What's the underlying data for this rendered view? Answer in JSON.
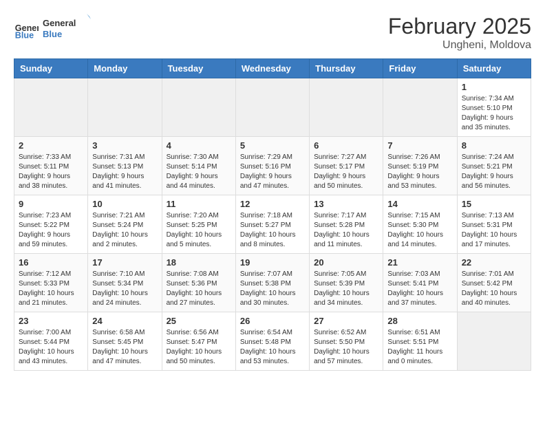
{
  "header": {
    "logo_line1": "General",
    "logo_line2": "Blue",
    "month_year": "February 2025",
    "location": "Ungheni, Moldova"
  },
  "weekdays": [
    "Sunday",
    "Monday",
    "Tuesday",
    "Wednesday",
    "Thursday",
    "Friday",
    "Saturday"
  ],
  "weeks": [
    [
      {
        "day": "",
        "empty": true
      },
      {
        "day": "",
        "empty": true
      },
      {
        "day": "",
        "empty": true
      },
      {
        "day": "",
        "empty": true
      },
      {
        "day": "",
        "empty": true
      },
      {
        "day": "",
        "empty": true
      },
      {
        "day": "1",
        "sunrise": "7:34 AM",
        "sunset": "5:10 PM",
        "daylight": "9 hours and 35 minutes."
      }
    ],
    [
      {
        "day": "2",
        "sunrise": "7:33 AM",
        "sunset": "5:11 PM",
        "daylight": "9 hours and 38 minutes."
      },
      {
        "day": "3",
        "sunrise": "7:31 AM",
        "sunset": "5:13 PM",
        "daylight": "9 hours and 41 minutes."
      },
      {
        "day": "4",
        "sunrise": "7:30 AM",
        "sunset": "5:14 PM",
        "daylight": "9 hours and 44 minutes."
      },
      {
        "day": "5",
        "sunrise": "7:29 AM",
        "sunset": "5:16 PM",
        "daylight": "9 hours and 47 minutes."
      },
      {
        "day": "6",
        "sunrise": "7:27 AM",
        "sunset": "5:17 PM",
        "daylight": "9 hours and 50 minutes."
      },
      {
        "day": "7",
        "sunrise": "7:26 AM",
        "sunset": "5:19 PM",
        "daylight": "9 hours and 53 minutes."
      },
      {
        "day": "8",
        "sunrise": "7:24 AM",
        "sunset": "5:21 PM",
        "daylight": "9 hours and 56 minutes."
      }
    ],
    [
      {
        "day": "9",
        "sunrise": "7:23 AM",
        "sunset": "5:22 PM",
        "daylight": "9 hours and 59 minutes."
      },
      {
        "day": "10",
        "sunrise": "7:21 AM",
        "sunset": "5:24 PM",
        "daylight": "10 hours and 2 minutes."
      },
      {
        "day": "11",
        "sunrise": "7:20 AM",
        "sunset": "5:25 PM",
        "daylight": "10 hours and 5 minutes."
      },
      {
        "day": "12",
        "sunrise": "7:18 AM",
        "sunset": "5:27 PM",
        "daylight": "10 hours and 8 minutes."
      },
      {
        "day": "13",
        "sunrise": "7:17 AM",
        "sunset": "5:28 PM",
        "daylight": "10 hours and 11 minutes."
      },
      {
        "day": "14",
        "sunrise": "7:15 AM",
        "sunset": "5:30 PM",
        "daylight": "10 hours and 14 minutes."
      },
      {
        "day": "15",
        "sunrise": "7:13 AM",
        "sunset": "5:31 PM",
        "daylight": "10 hours and 17 minutes."
      }
    ],
    [
      {
        "day": "16",
        "sunrise": "7:12 AM",
        "sunset": "5:33 PM",
        "daylight": "10 hours and 21 minutes."
      },
      {
        "day": "17",
        "sunrise": "7:10 AM",
        "sunset": "5:34 PM",
        "daylight": "10 hours and 24 minutes."
      },
      {
        "day": "18",
        "sunrise": "7:08 AM",
        "sunset": "5:36 PM",
        "daylight": "10 hours and 27 minutes."
      },
      {
        "day": "19",
        "sunrise": "7:07 AM",
        "sunset": "5:38 PM",
        "daylight": "10 hours and 30 minutes."
      },
      {
        "day": "20",
        "sunrise": "7:05 AM",
        "sunset": "5:39 PM",
        "daylight": "10 hours and 34 minutes."
      },
      {
        "day": "21",
        "sunrise": "7:03 AM",
        "sunset": "5:41 PM",
        "daylight": "10 hours and 37 minutes."
      },
      {
        "day": "22",
        "sunrise": "7:01 AM",
        "sunset": "5:42 PM",
        "daylight": "10 hours and 40 minutes."
      }
    ],
    [
      {
        "day": "23",
        "sunrise": "7:00 AM",
        "sunset": "5:44 PM",
        "daylight": "10 hours and 43 minutes."
      },
      {
        "day": "24",
        "sunrise": "6:58 AM",
        "sunset": "5:45 PM",
        "daylight": "10 hours and 47 minutes."
      },
      {
        "day": "25",
        "sunrise": "6:56 AM",
        "sunset": "5:47 PM",
        "daylight": "10 hours and 50 minutes."
      },
      {
        "day": "26",
        "sunrise": "6:54 AM",
        "sunset": "5:48 PM",
        "daylight": "10 hours and 53 minutes."
      },
      {
        "day": "27",
        "sunrise": "6:52 AM",
        "sunset": "5:50 PM",
        "daylight": "10 hours and 57 minutes."
      },
      {
        "day": "28",
        "sunrise": "6:51 AM",
        "sunset": "5:51 PM",
        "daylight": "11 hours and 0 minutes."
      },
      {
        "day": "",
        "empty": true
      }
    ]
  ]
}
